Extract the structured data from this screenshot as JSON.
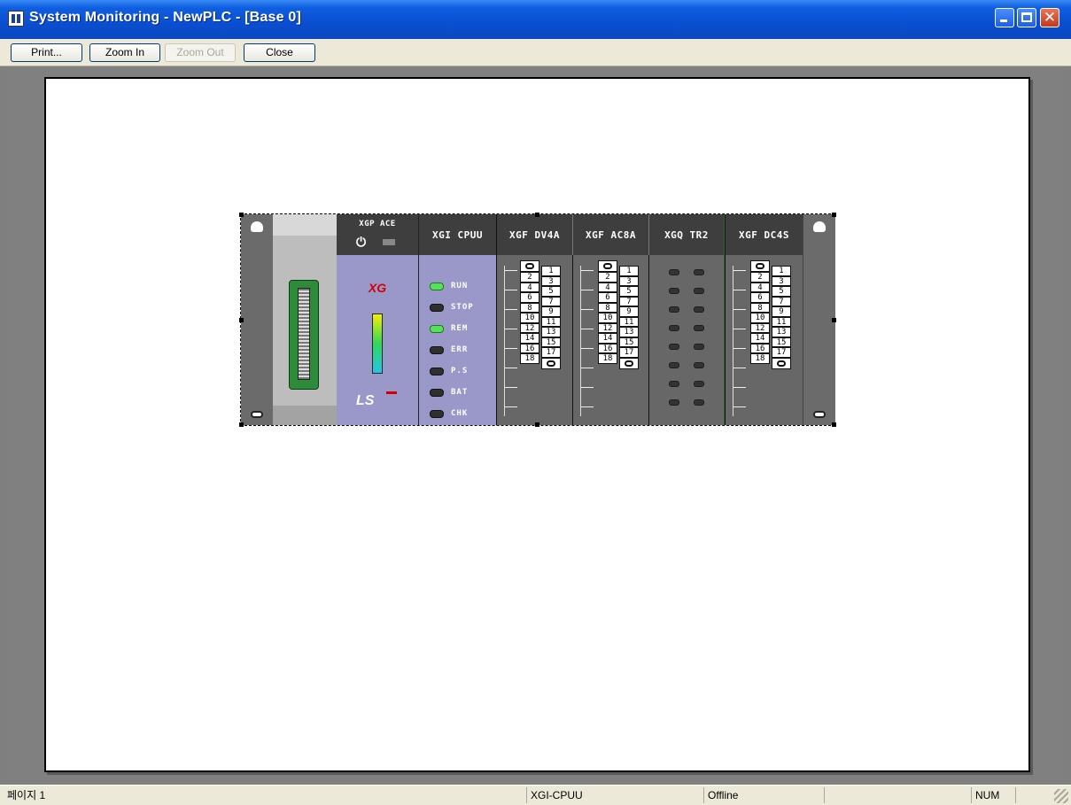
{
  "window": {
    "title": "System Monitoring - NewPLC - [Base 0]",
    "controls": [
      "minimize",
      "maximize",
      "close"
    ]
  },
  "toolbar": {
    "print_label": "Print...",
    "zoom_in_label": "Zoom In",
    "zoom_out_label": "Zoom Out",
    "close_label": "Close",
    "zoom_out_enabled": false
  },
  "rack": {
    "slots": [
      {
        "id": "connector",
        "module": ""
      },
      {
        "id": "power",
        "module": "XGP  ACE",
        "logo": "XG",
        "brand": "LS"
      },
      {
        "id": "cpu",
        "module": "XGI  CPUU",
        "leds": [
          {
            "label": "RUN",
            "on": true
          },
          {
            "label": "STOP",
            "on": false
          },
          {
            "label": "REM",
            "on": true
          },
          {
            "label": "ERR",
            "on": false
          },
          {
            "label": "P.S",
            "on": false
          },
          {
            "label": "BAT",
            "on": false
          },
          {
            "label": "CHK",
            "on": false
          }
        ]
      },
      {
        "id": "dv4a",
        "module": "XGF  DV4A"
      },
      {
        "id": "ac8a",
        "module": "XGF  AC8A"
      },
      {
        "id": "tr2",
        "module": "XGQ  TR2"
      },
      {
        "id": "dc4s",
        "module": "XGF  DC4S"
      }
    ],
    "terminal_left": [
      "2",
      "4",
      "6",
      "8",
      "10",
      "12",
      "14",
      "16",
      "18"
    ],
    "terminal_right": [
      "1",
      "3",
      "5",
      "7",
      "9",
      "11",
      "13",
      "15",
      "17"
    ]
  },
  "statusbar": {
    "page": "페이지 1",
    "cpu": "XGI-CPUU",
    "mode": "Offline",
    "empty": "",
    "num": "NUM"
  },
  "colors": {
    "titlebar": "#0a4fd1",
    "led_on": "#57e05a",
    "module_purple": "#9a98c9",
    "rack_gray": "#676767"
  }
}
